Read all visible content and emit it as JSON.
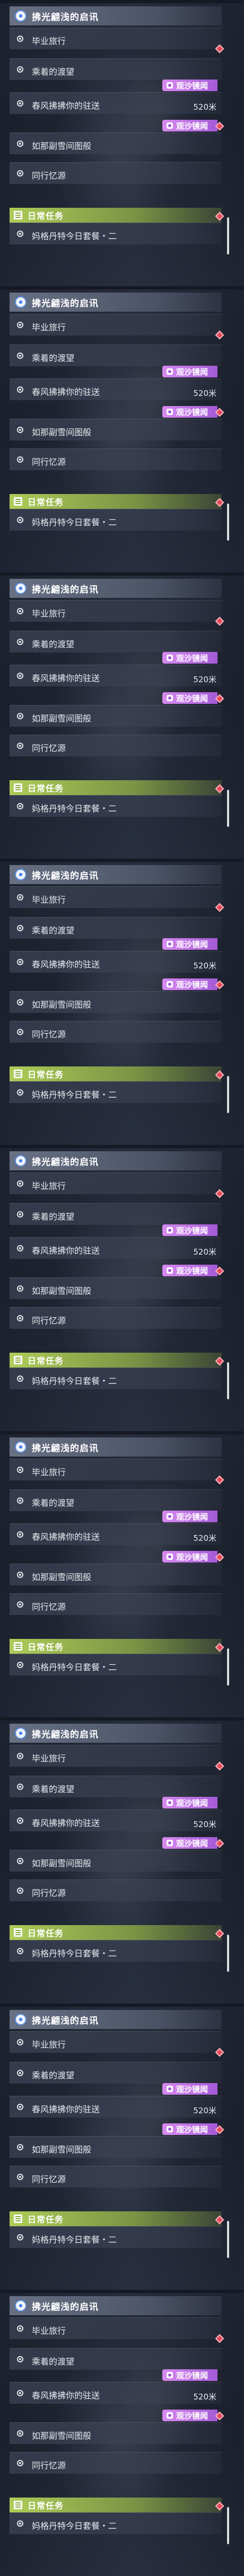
{
  "block_count": 9,
  "panel": {
    "header_title": "拂光翩浅的启讯",
    "quests": [
      {
        "label": "毕业旅行"
      },
      {
        "label": "乘着的渡望"
      },
      {
        "label": "春风拂拂你的驻送",
        "tag": "观沙镜闻"
      },
      {
        "label": "如那副雪间图般",
        "tag": "观沙镜闻"
      },
      {
        "label": "同行忆源"
      }
    ],
    "tag_distance": "520米",
    "daily_section_title": "日常任务",
    "daily_quest_label": "妈格丹特今日套餐・二"
  },
  "colors": {
    "tag": "#c07ae6",
    "daily": "#b6d65a",
    "diamond": "#e34a5a",
    "header_icon": "#3b7cf0"
  },
  "icons": {
    "header": "quest-target-icon",
    "bullet": "ring-bullet-icon",
    "tag": "camera-tag-icon",
    "marker": "red-diamond-marker-icon",
    "daily": "daily-list-icon"
  }
}
